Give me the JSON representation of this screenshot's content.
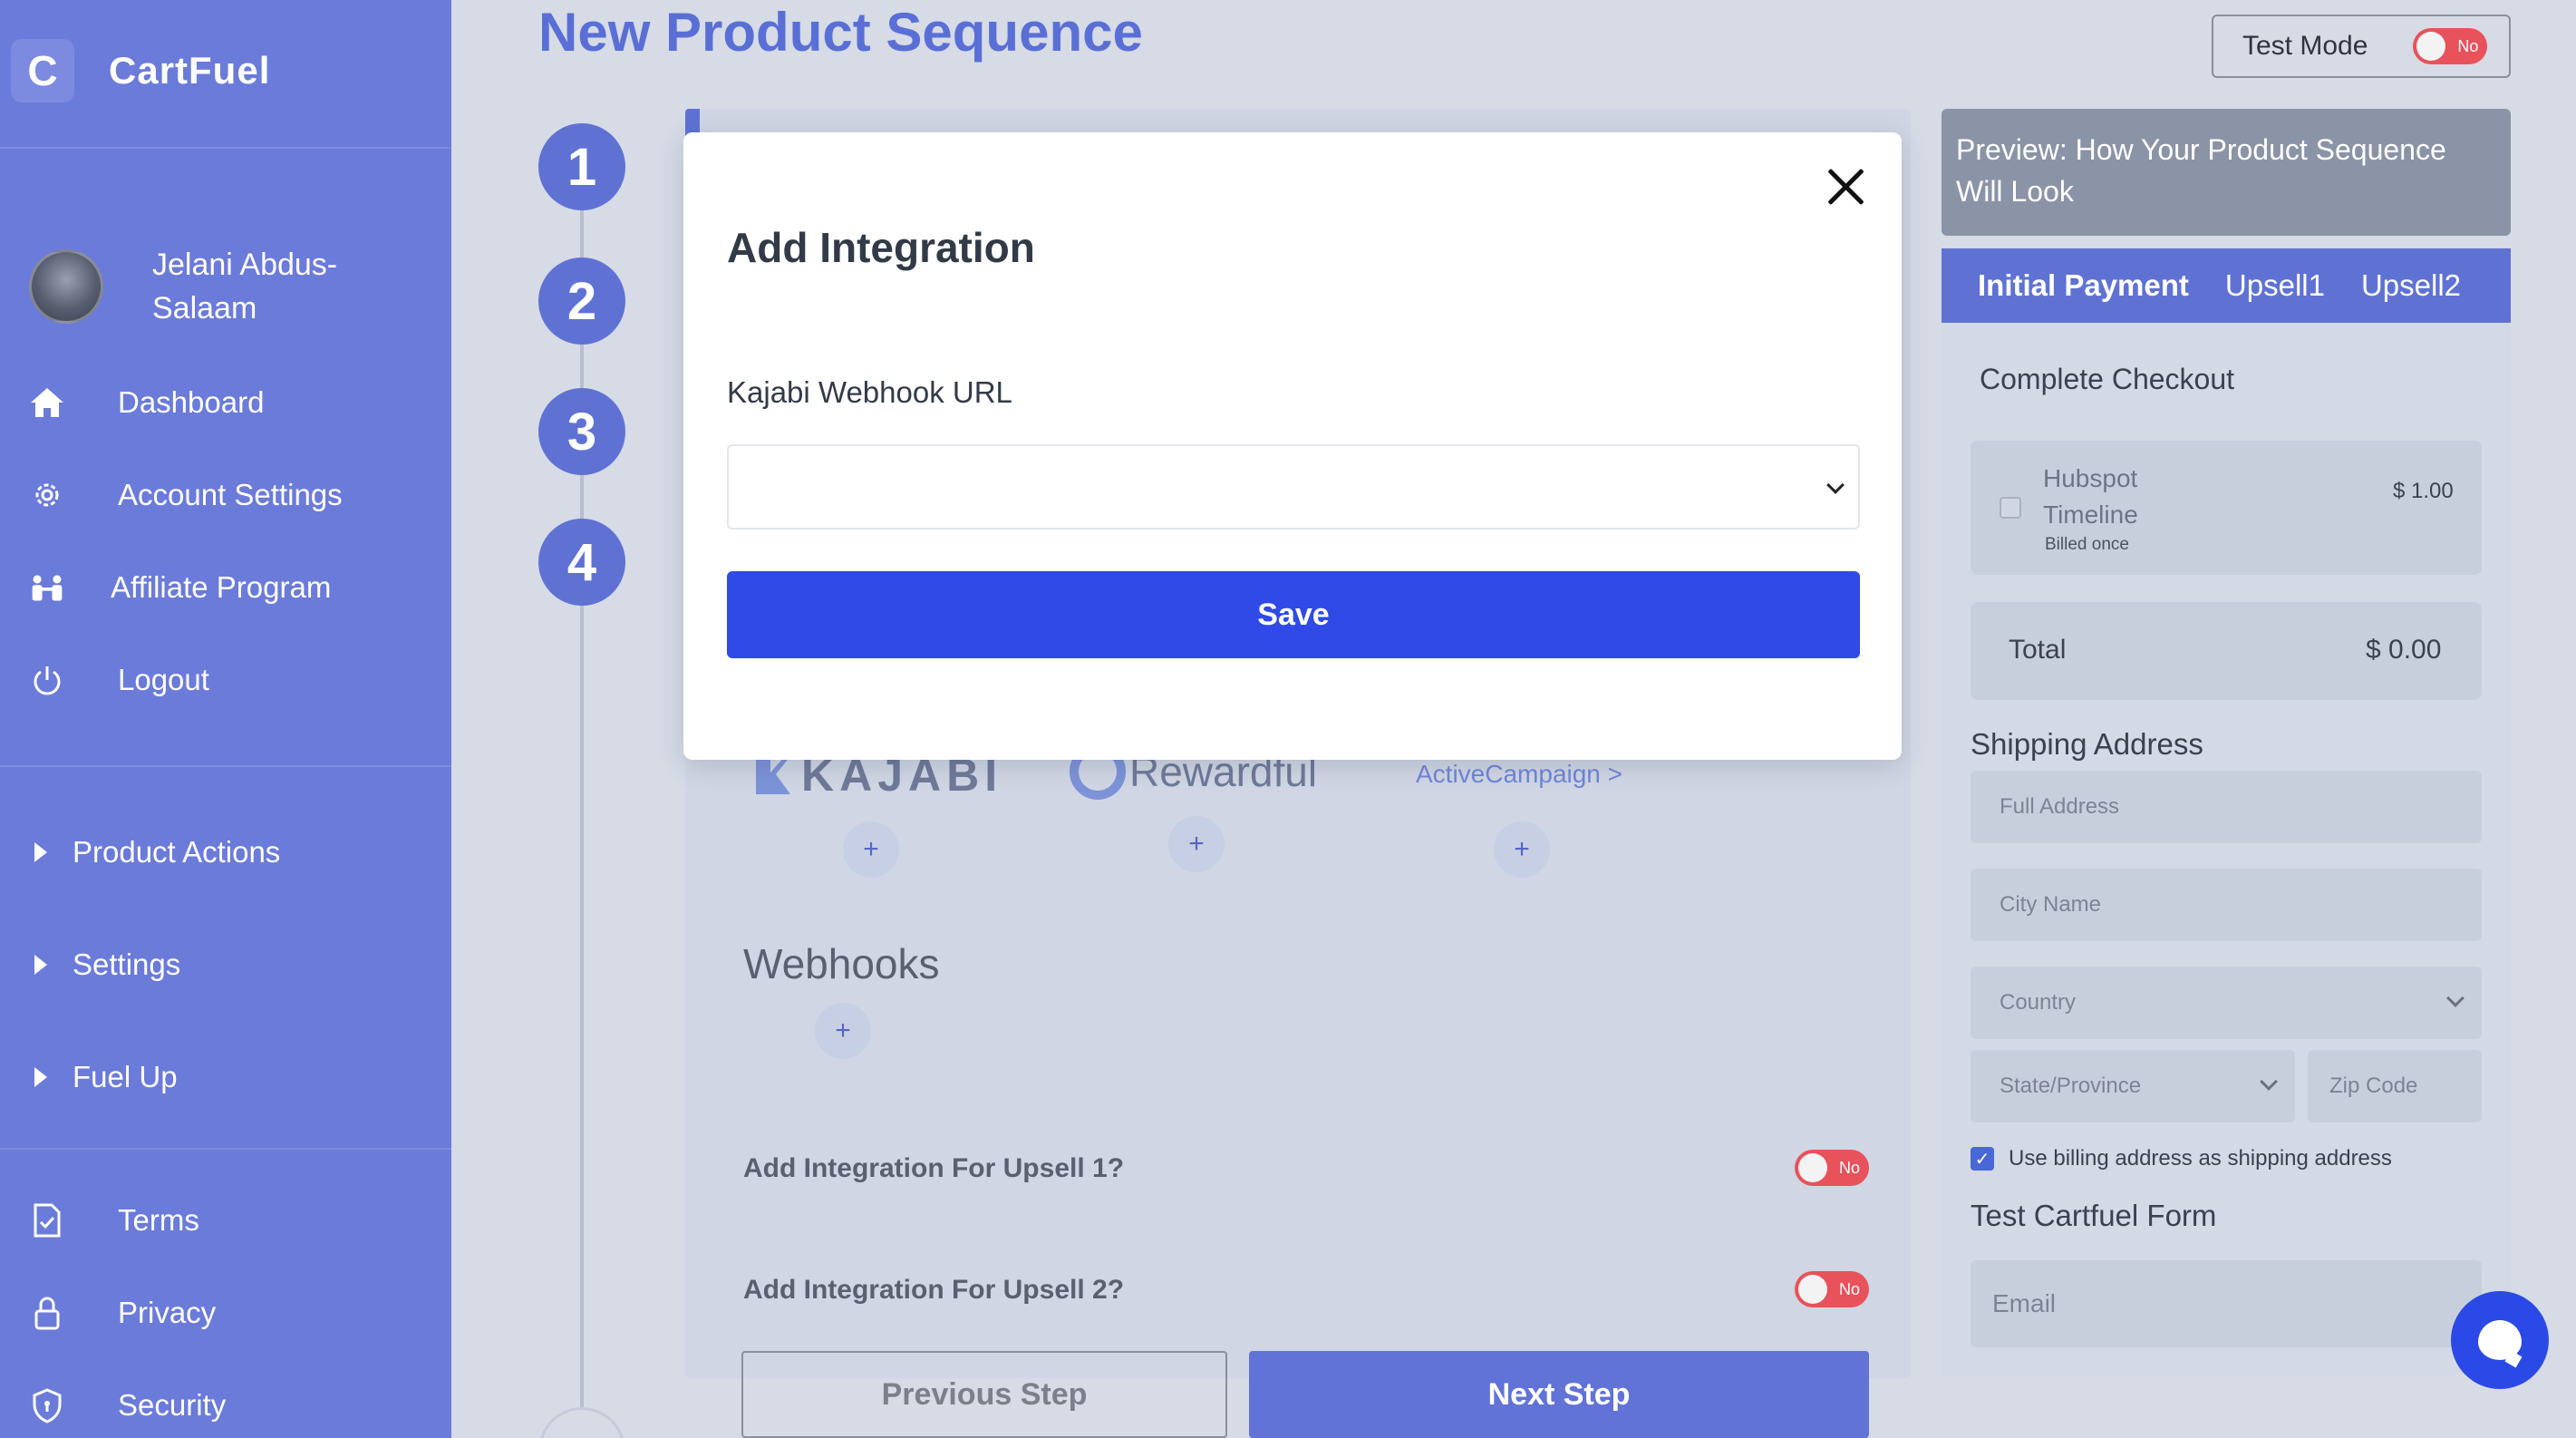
{
  "brand": {
    "logo_letter": "C",
    "name": "CartFuel"
  },
  "user": {
    "name": "Jelani Abdus-Salaam"
  },
  "sidebar": {
    "nav": [
      {
        "label": "Dashboard",
        "icon": "home-icon"
      },
      {
        "label": "Account Settings",
        "icon": "gear-icon"
      },
      {
        "label": "Affiliate Program",
        "icon": "people-icon"
      },
      {
        "label": "Logout",
        "icon": "power-icon"
      }
    ],
    "groups": [
      {
        "label": "Product Actions"
      },
      {
        "label": "Settings"
      },
      {
        "label": "Fuel Up"
      }
    ],
    "footer": [
      {
        "label": "Terms",
        "icon": "document-check-icon"
      },
      {
        "label": "Privacy",
        "icon": "lock-icon"
      },
      {
        "label": "Security",
        "icon": "shield-icon"
      }
    ]
  },
  "header": {
    "title": "New Product Sequence",
    "test_mode_label": "Test Mode",
    "test_mode_toggle": "No"
  },
  "steps": [
    "1",
    "2",
    "3",
    "4"
  ],
  "integrations": {
    "kajabi": "KAJABI",
    "rewardful": "Rewardful",
    "activecampaign": "ActiveCampaign",
    "activecampaign_arrow": ">",
    "plus": "+"
  },
  "webhooks": {
    "title": "Webhooks",
    "plus": "+"
  },
  "upsell_rows": [
    {
      "label": "Add Integration For Upsell 1?",
      "toggle": "No"
    },
    {
      "label": "Add Integration For Upsell 2?",
      "toggle": "No"
    }
  ],
  "nav_buttons": {
    "previous": "Previous Step",
    "next": "Next Step"
  },
  "preview": {
    "title": "Preview: How Your Product Sequence Will Look",
    "tabs": [
      "Initial Payment",
      "Upsell1",
      "Upsell2"
    ],
    "checkout_title": "Complete Checkout",
    "item": {
      "name_line1": "Hubspot",
      "name_line2": "Timeline",
      "billing": "Billed once",
      "price": "$ 1.00"
    },
    "total_label": "Total",
    "total_value": "$ 0.00",
    "shipping_title": "Shipping Address",
    "fields": {
      "full_address": "Full Address",
      "city": "City Name",
      "country": "Country",
      "state": "State/Province",
      "zip": "Zip Code"
    },
    "use_billing": "Use billing address as shipping address",
    "test_form_title": "Test Cartfuel Form",
    "email_placeholder": "Email"
  },
  "modal": {
    "title": "Add Integration",
    "field_label": "Kajabi Webhook URL",
    "select_value": "",
    "save_label": "Save"
  },
  "colors": {
    "sidebar": "#6b7bd9",
    "accent": "#5f72d4",
    "save_button": "#2f4ae6",
    "toggle_off": "#e8525b"
  }
}
